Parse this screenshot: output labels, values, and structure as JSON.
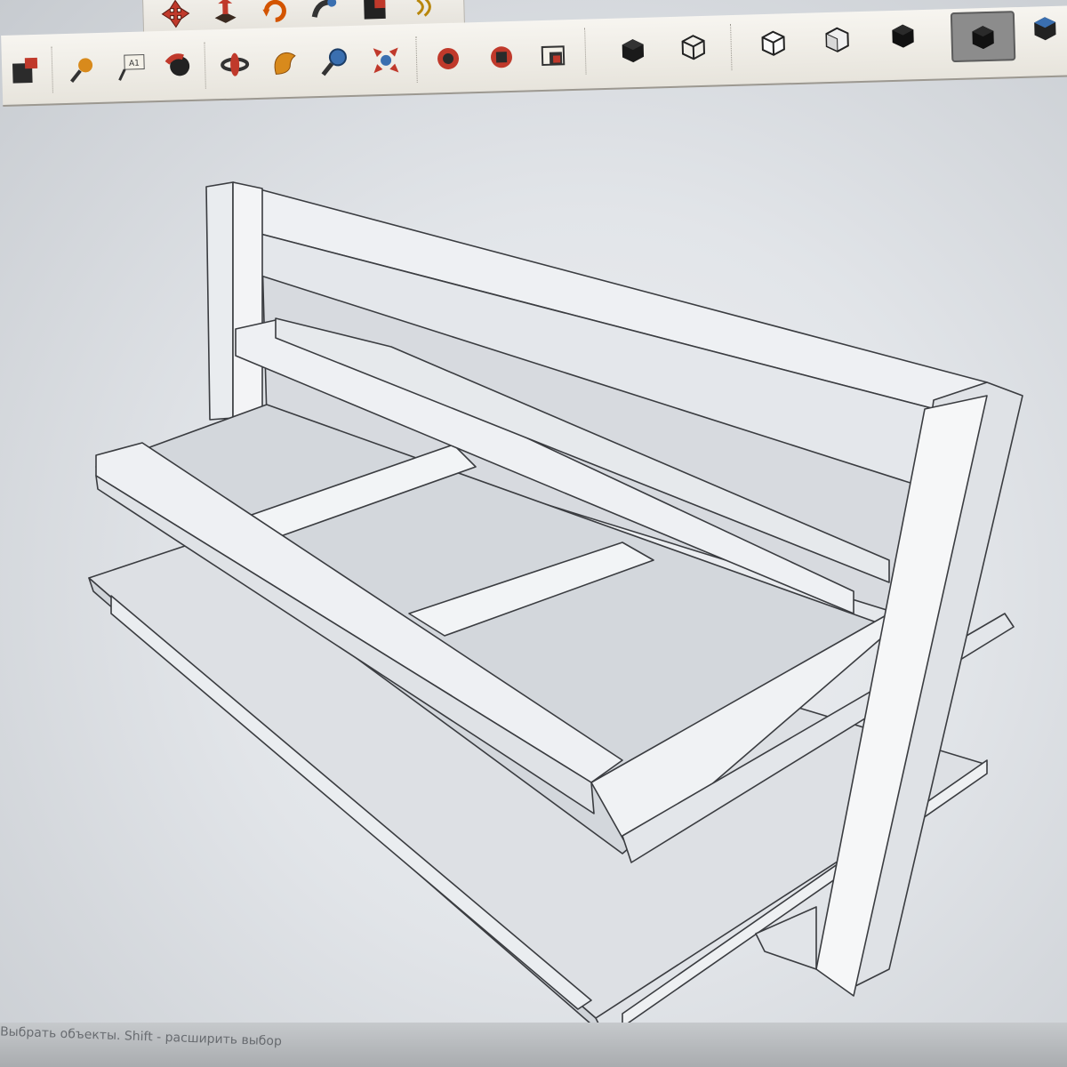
{
  "app": {
    "accent": "#3a6fb0"
  },
  "toolbar_top": {
    "buttons": [
      {
        "name": "move-icon"
      },
      {
        "name": "pushpull-icon"
      },
      {
        "name": "rotate-icon"
      },
      {
        "name": "followme-icon"
      },
      {
        "name": "scale-icon"
      },
      {
        "name": "offset-icon"
      }
    ]
  },
  "toolbar_main": {
    "buttons": [
      {
        "name": "paint-bucket-icon"
      },
      {
        "name": "tape-measure-icon"
      },
      {
        "name": "text-label-icon"
      },
      {
        "name": "axes-icon"
      },
      {
        "name": "orbit-icon"
      },
      {
        "name": "pan-icon"
      },
      {
        "name": "zoom-icon"
      },
      {
        "name": "zoom-extents-icon"
      },
      {
        "name": "get-models-icon"
      },
      {
        "name": "share-model-icon"
      },
      {
        "name": "extension-warehouse-icon"
      },
      {
        "name": "xray-style-icon"
      },
      {
        "name": "wireframe-style-icon"
      },
      {
        "name": "hidden-line-style-icon"
      },
      {
        "name": "shaded-style-icon"
      },
      {
        "name": "shaded-textures-style-icon"
      },
      {
        "name": "monochrome-style-icon"
      },
      {
        "name": "iso-view-icon"
      }
    ],
    "active_button": "monochrome-style-icon"
  },
  "status_bar": {
    "text": "Выбрать объекты. Shift - расширить выбор"
  }
}
